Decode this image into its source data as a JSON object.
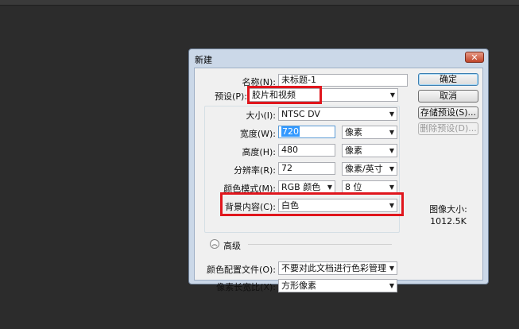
{
  "dialog": {
    "title": "新建",
    "close_symbol": "✕"
  },
  "form": {
    "name_label": "名称(N):",
    "name_value": "未标题-1",
    "preset_label": "预设(P):",
    "preset_value": "胶片和视频",
    "size_label": "大小(I):",
    "size_value": "NTSC DV",
    "width_label": "宽度(W):",
    "width_value": "720",
    "width_unit": "像素",
    "height_label": "高度(H):",
    "height_value": "480",
    "height_unit": "像素",
    "resolution_label": "分辨率(R):",
    "resolution_value": "72",
    "resolution_unit": "像素/英寸",
    "color_mode_label": "颜色模式(M):",
    "color_mode_value": "RGB 颜色",
    "bit_depth_value": "8 位",
    "background_label": "背景内容(C):",
    "background_value": "白色",
    "advanced_label": "高级",
    "advanced_icon_glyph": "︽",
    "color_profile_label": "颜色配置文件(O):",
    "color_profile_value": "不要对此文档进行色彩管理",
    "pixel_aspect_label": "像素长宽比(X):",
    "pixel_aspect_value": "方形像素"
  },
  "buttons": {
    "ok": "确定",
    "cancel": "取消",
    "save_preset": "存储预设(S)...",
    "delete_preset": "删除预设(D)..."
  },
  "info": {
    "image_size_label": "图像大小:",
    "image_size_value": "1012.5K"
  },
  "icons": {
    "dropdown_arrow": "▼"
  },
  "colors": {
    "highlight_box": "#e0161d",
    "dialog_frame": "#cbd8e8"
  }
}
